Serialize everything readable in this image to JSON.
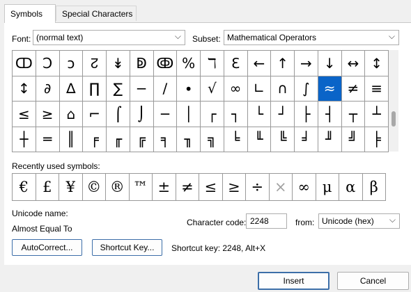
{
  "tabs": [
    {
      "label": "Symbols",
      "active": true
    },
    {
      "label": "Special Characters",
      "active": false
    }
  ],
  "font": {
    "label": "Font:",
    "value": "(normal text)"
  },
  "subset": {
    "label": "Subset:",
    "value": "Mathematical Operators"
  },
  "symbol_grid": [
    [
      "ↀ",
      "Ↄ",
      "ↄ",
      "↊",
      "↡",
      "ↁ",
      "ↂ",
      "%",
      "ℸ",
      "ℇ",
      "←",
      "↑",
      "→",
      "↓",
      "↔",
      "↕"
    ],
    [
      "↕",
      "∂",
      "∆",
      "∏",
      "∑",
      "−",
      "∕",
      "∙",
      "√",
      "∞",
      "∟",
      "∩",
      "∫",
      "≈",
      "≠",
      "≡"
    ],
    [
      "≤",
      "≥",
      "⌂",
      "⌐",
      "⌠",
      "⌡",
      "─",
      "│",
      "┌",
      "┐",
      "└",
      "┘",
      "├",
      "┤",
      "┬",
      "┴"
    ],
    [
      "┼",
      "═",
      "║",
      "╒",
      "╓",
      "╔",
      "╕",
      "╖",
      "╗",
      "╘",
      "╙",
      "╚",
      "╛",
      "╜",
      "╝",
      "╞"
    ]
  ],
  "symbol_grid_selected": {
    "row": 1,
    "col": 13
  },
  "recent": {
    "label": "Recently used symbols:",
    "symbols": [
      "€",
      "£",
      "¥",
      "©",
      "®",
      "™",
      "±",
      "≠",
      "≤",
      "≥",
      "÷",
      "×",
      "∞",
      "μ",
      "α",
      "β"
    ],
    "dimmed": [
      11
    ]
  },
  "unicode_name": {
    "label": "Unicode name:",
    "value": "Almost Equal To"
  },
  "character_code": {
    "label": "Character code:",
    "value": "2248"
  },
  "from": {
    "label": "from:",
    "value": "Unicode (hex)"
  },
  "buttons": {
    "autocorrect": "AutoCorrect...",
    "shortcut_key": "Shortcut Key...",
    "insert": "Insert",
    "cancel": "Cancel"
  },
  "shortcut_text": "Shortcut key: 2248, Alt+X",
  "colors": {
    "selection": "#0a64c8",
    "button_border": "#3c6ea8"
  }
}
